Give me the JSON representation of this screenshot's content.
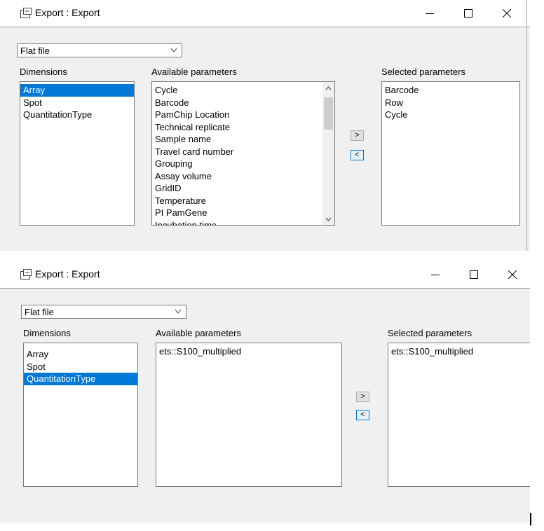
{
  "window1": {
    "title": "Export : Export",
    "format": "Flat file",
    "dimensions_label": "Dimensions",
    "dimensions": [
      {
        "label": "Array",
        "selected": true
      },
      {
        "label": "Spot",
        "selected": false
      },
      {
        "label": "QuantitationType",
        "selected": false
      }
    ],
    "available_label": "Available parameters",
    "available": [
      "Cycle",
      "Barcode",
      "PamChip Location",
      "Technical replicate",
      "Sample name",
      "Travel card number",
      "Grouping",
      "Assay volume",
      "GridID",
      "Temperature",
      "PI PamGene",
      "Incubation time"
    ],
    "selected_label": "Selected parameters",
    "selected": [
      "Barcode",
      "Row",
      "Cycle"
    ],
    "add_button": ">",
    "remove_button": "<"
  },
  "window2": {
    "title": "Export : Export",
    "format": "Flat file",
    "dimensions_label": "Dimensions",
    "dimensions": [
      {
        "label": "Array",
        "selected": false
      },
      {
        "label": "Spot",
        "selected": false
      },
      {
        "label": "QuantitationType",
        "selected": true
      }
    ],
    "available_label": "Available parameters",
    "available": [
      "ets::S100_multiplied"
    ],
    "selected_label": "Selected parameters",
    "selected": [
      "ets::S100_multiplied"
    ],
    "add_button": ">",
    "remove_button": "<"
  },
  "icons": {
    "window_icon": "export-window-icon",
    "minimize": "minimize-icon",
    "maximize": "maximize-icon",
    "close": "close-icon",
    "dropdown": "chevron-down-icon"
  },
  "colors": {
    "selection": "#0078d7",
    "window_bg": "#f0f0f0",
    "titlebar_bg": "#ffffff"
  }
}
